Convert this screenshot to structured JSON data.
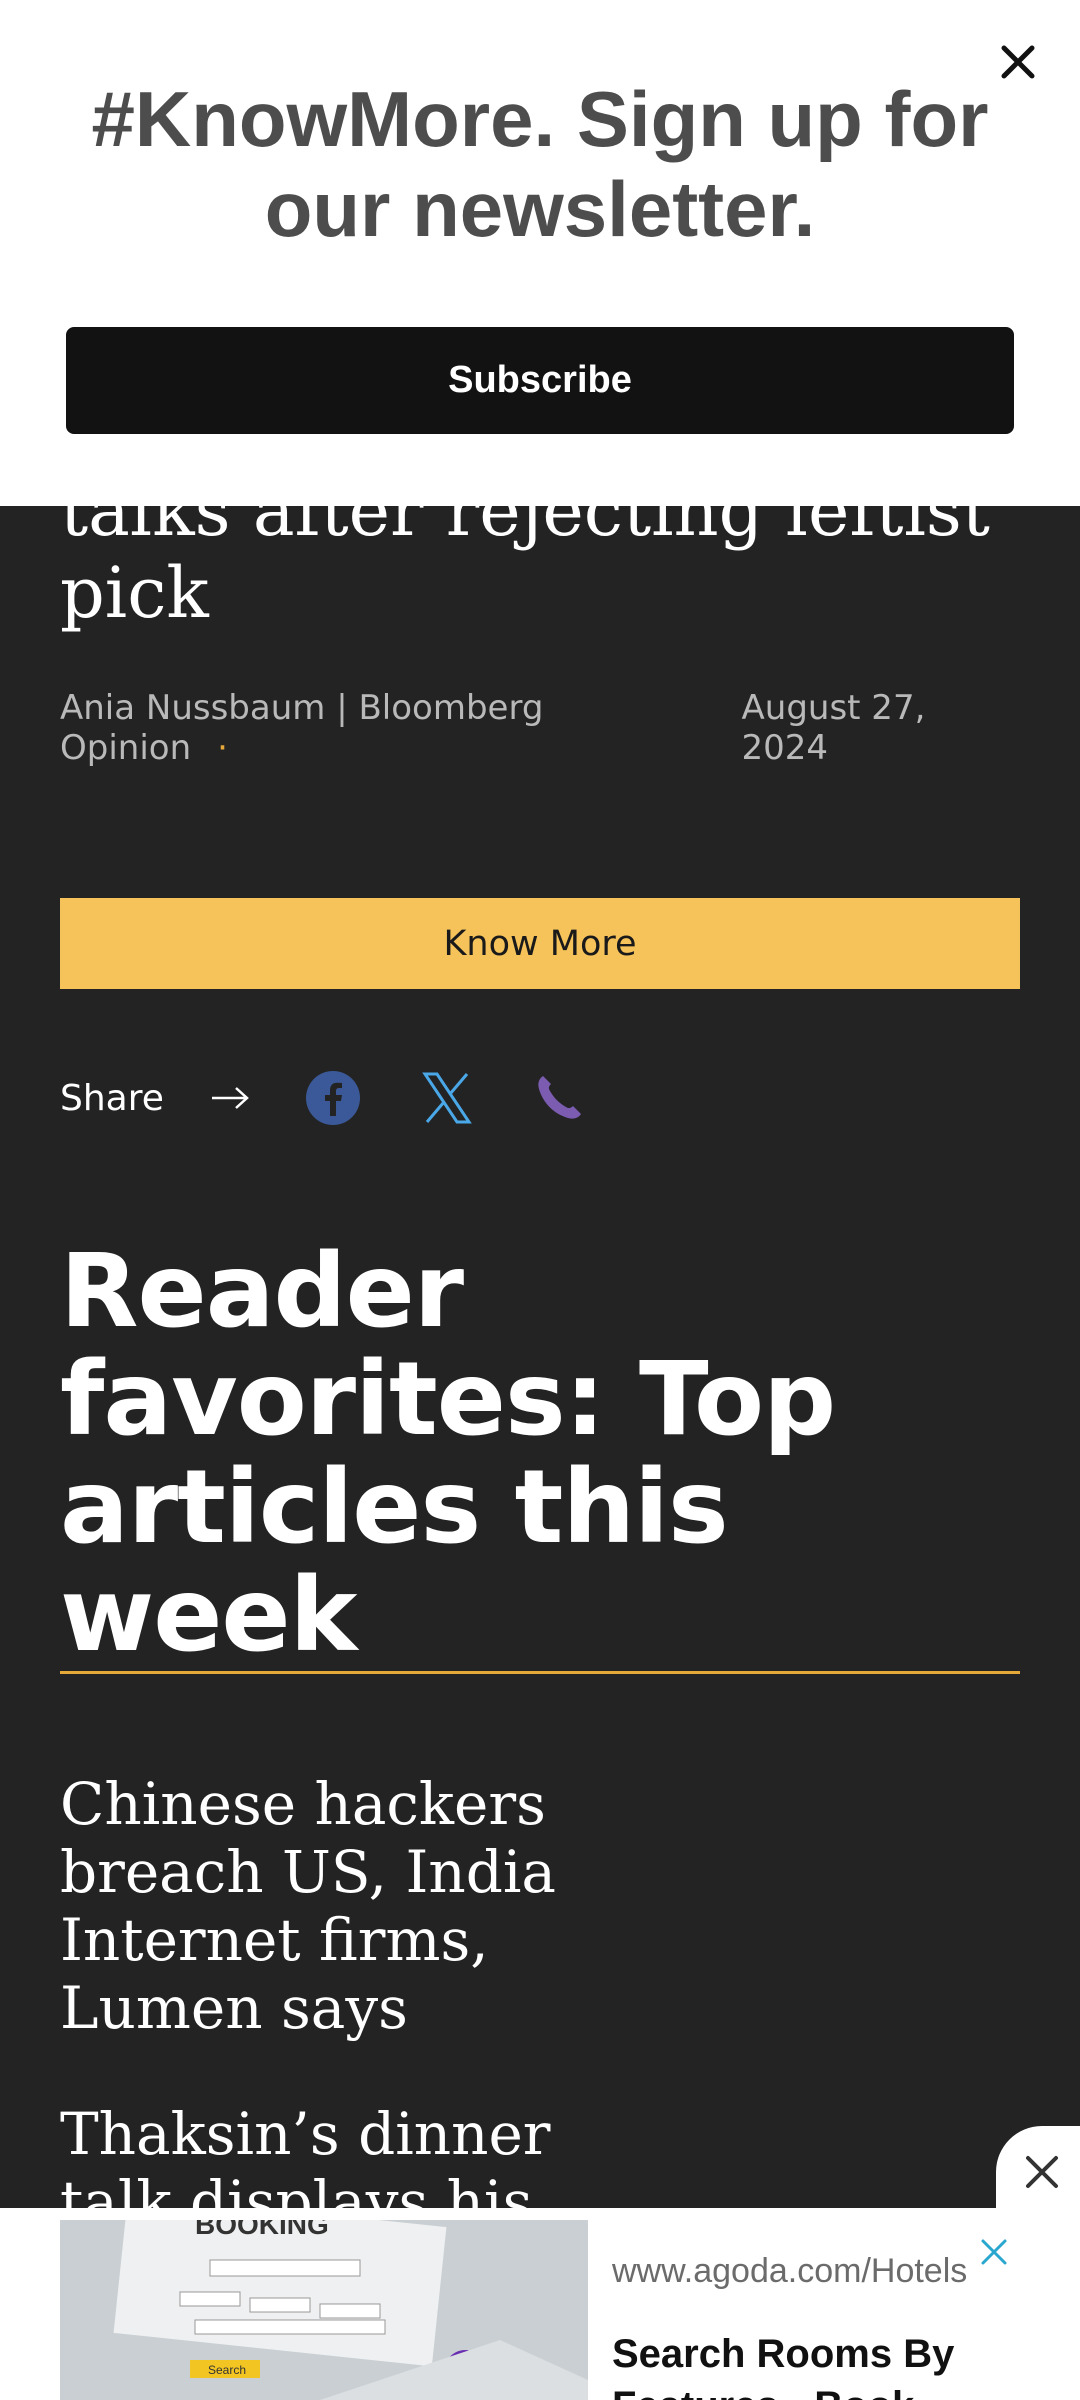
{
  "article": {
    "headline_lines": [
      "talks after rejecting leftist",
      "pick"
    ],
    "author": "Ania Nussbaum | Bloomberg Opinion",
    "separator": "·",
    "date": "August 27, 2024",
    "know_more_label": "Know More",
    "share_label": "Share",
    "share_icons": [
      "facebook-icon",
      "x-icon",
      "phone-icon"
    ],
    "accent_color": "#f5c35a"
  },
  "favorites": {
    "title": "Reader favorites: Top articles this week",
    "stories": [
      "Chinese hackers breach US, India Internet firms, Lumen says",
      "Thaksin’s dinner talk displays his clout in"
    ]
  },
  "newsletter": {
    "title": "#KnowMore. Sign up for our newsletter.",
    "subscribe_label": "Subscribe",
    "close_icon": "close-icon"
  },
  "ad": {
    "url": "www.agoda.com/Hotels",
    "headline": "Search Rooms By Features - Book",
    "image_text": "BOOKING",
    "search_text": "Search"
  }
}
